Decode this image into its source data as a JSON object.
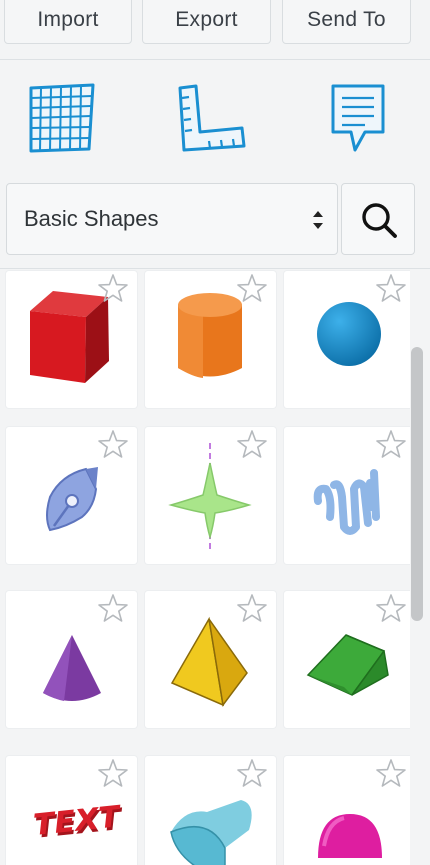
{
  "toolbar": {
    "import_label": "Import",
    "export_label": "Export",
    "send_to_label": "Send To"
  },
  "tools": [
    {
      "name": "workplane-icon"
    },
    {
      "name": "ruler-icon"
    },
    {
      "name": "notes-icon"
    }
  ],
  "category_selector": {
    "selected": "Basic Shapes"
  },
  "colors": {
    "accent": "#1a8fd1",
    "background": "#f3f4f5",
    "tile": "#ffffff",
    "scrollbar": "#c4c6c8"
  },
  "shapes": [
    {
      "name": "box",
      "color": "#d71920"
    },
    {
      "name": "cylinder",
      "color": "#e8761c"
    },
    {
      "name": "sphere",
      "color": "#1c8fd0"
    },
    {
      "name": "scribble",
      "color": "#8ea4e0"
    },
    {
      "name": "shape-generator",
      "color": "#a9e58a"
    },
    {
      "name": "text-scribble",
      "color": "#8fb6e6"
    },
    {
      "name": "cone",
      "color": "#7b3aa1"
    },
    {
      "name": "pyramid",
      "color": "#f0c91f"
    },
    {
      "name": "roof",
      "color": "#3daa3a"
    },
    {
      "name": "text",
      "color": "#d81f2a"
    },
    {
      "name": "round-roof",
      "color": "#57b9d2"
    },
    {
      "name": "half-sphere",
      "color": "#de1ea0"
    }
  ]
}
